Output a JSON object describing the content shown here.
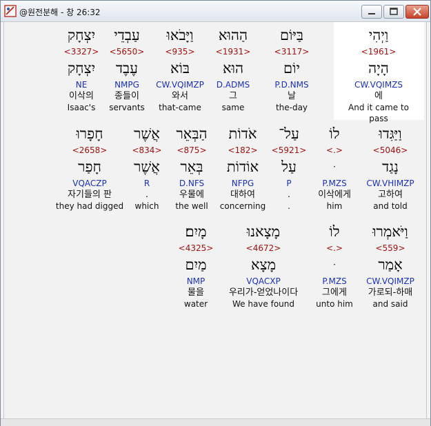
{
  "window": {
    "title": "@원전분해 - 창 26:32"
  },
  "verse_rows": [
    [
      {
        "hebrew": "וַיְהִי",
        "strong": "<1961>",
        "lemma": "הָיָה",
        "parse": "CW.VQIMZS",
        "korean": "에",
        "english": "And it came to pass"
      },
      {
        "hebrew": "בַּיּוֹם",
        "strong": "<3117>",
        "lemma": "יוֹם",
        "parse": "P.D.NMS",
        "korean": "날",
        "english": "the-day"
      },
      {
        "hebrew": "הַהוּא",
        "strong": "<1931>",
        "lemma": "הוּא",
        "parse": "D.ADMS",
        "korean": "그",
        "english": "same"
      },
      {
        "hebrew": "וַיָּבֹאוּ",
        "strong": "<935>",
        "lemma": "בּוֹא",
        "parse": "CW.VQIMZP",
        "korean": "와서",
        "english": "that-came"
      },
      {
        "hebrew": "עַבְדֵי",
        "strong": "<5650>",
        "lemma": "עֶבֶד",
        "parse": "NMPG",
        "korean": "종들이",
        "english": "servants"
      },
      {
        "hebrew": "יִצְחָק",
        "strong": "<3327>",
        "lemma": "יִצְחָק",
        "parse": "NE",
        "korean": "이삭의",
        "english": "Isaac's"
      }
    ],
    [
      {
        "hebrew": "וַיַּגִּדוּ",
        "strong": "<5046>",
        "lemma": "נָגַד",
        "parse": "CW.VHIMZP",
        "korean": "고하여",
        "english": "and told"
      },
      {
        "hebrew": "לוֹ",
        "strong": "<.>",
        "lemma": "ּ",
        "parse": "P.MZS",
        "korean": "이삭에게",
        "english": "him"
      },
      {
        "hebrew": "עַל־",
        "strong": "<5921>",
        "lemma": "עַל",
        "parse": "P",
        "korean": ".",
        "english": "."
      },
      {
        "hebrew": "אֹדוֹת",
        "strong": "<182>",
        "lemma": "אוֹדוֹת",
        "parse": "NFPG",
        "korean": "대하여",
        "english": "concerning"
      },
      {
        "hebrew": "הַבְּאֵר",
        "strong": "<875>",
        "lemma": "בְּאֵר",
        "parse": "D.NFS",
        "korean": "우물에",
        "english": "the well"
      },
      {
        "hebrew": "אֲשֶׁר",
        "strong": "<834>",
        "lemma": "אֲשֶׁר",
        "parse": "R",
        "korean": ".",
        "english": "which"
      },
      {
        "hebrew": "חָפָרוּ",
        "strong": "<2658>",
        "lemma": "חָפַר",
        "parse": "VQACZP",
        "korean": "자기들의 판",
        "english": "they had digged"
      }
    ],
    [
      {
        "hebrew": "וַיֹּאמְרוּ",
        "strong": "<559>",
        "lemma": "אָמַר",
        "parse": "CW.VQIMZP",
        "korean": "가로되-하매",
        "english": "and said"
      },
      {
        "hebrew": "לוֹ",
        "strong": "<.>",
        "lemma": "ּ",
        "parse": "P.MZS",
        "korean": "그에게",
        "english": "unto him"
      },
      {
        "hebrew": "מָצָאנוּ",
        "strong": "<4672>",
        "lemma": "מָצָא",
        "parse": "VQACXP",
        "korean": "우리가-얻었나이다",
        "english": "We have found"
      },
      {
        "hebrew": "מָיִם׃",
        "strong": "<4325>",
        "lemma": "מַיִם",
        "parse": "NMP",
        "korean": "물을",
        "english": "water"
      }
    ]
  ]
}
